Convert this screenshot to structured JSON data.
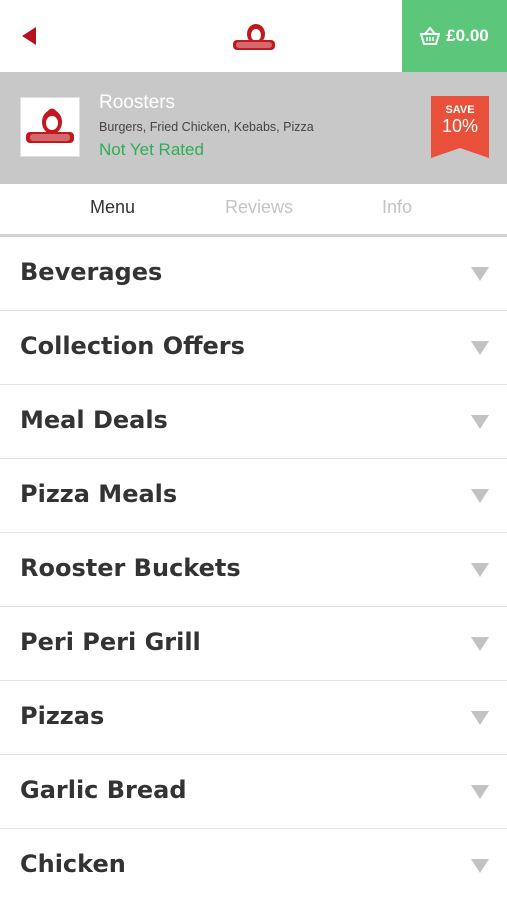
{
  "topbar": {
    "back_icon": "back-arrow-icon",
    "logo_icon": "roosters-logo-icon",
    "basket_icon": "basket-icon",
    "basket_total": "£0.00",
    "accent_color": "#5cc67b"
  },
  "restaurant": {
    "name": "Roosters",
    "cuisines": "Burgers, Fried Chicken, Kebabs, Pizza",
    "rating_text": "Not Yet Rated",
    "rating_color": "#2dae55",
    "discount": {
      "label": "SAVE",
      "percent": "10%",
      "color": "#e8503a"
    }
  },
  "tabs": [
    {
      "label": "Menu",
      "active": true
    },
    {
      "label": "Reviews",
      "active": false
    },
    {
      "label": "Info",
      "active": false
    }
  ],
  "menu_categories": [
    {
      "label": "Beverages"
    },
    {
      "label": "Collection Offers"
    },
    {
      "label": "Meal Deals"
    },
    {
      "label": "Pizza Meals"
    },
    {
      "label": "Rooster Buckets"
    },
    {
      "label": "Peri Peri Grill"
    },
    {
      "label": "Pizzas"
    },
    {
      "label": "Garlic Bread"
    },
    {
      "label": "Chicken"
    }
  ]
}
